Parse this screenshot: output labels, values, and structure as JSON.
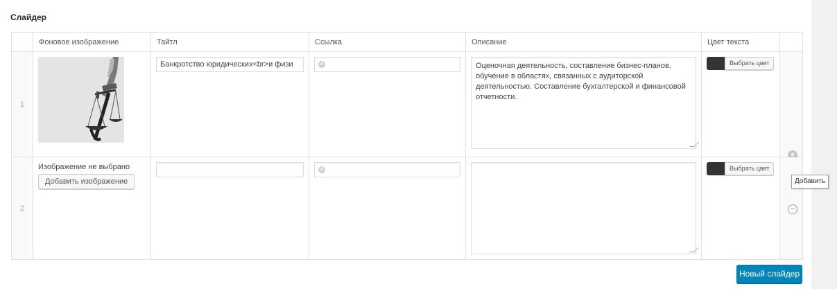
{
  "section_title": "Слайдер",
  "columns": {
    "bg_image": "Фоновое изображение",
    "title": "Тайтл",
    "link": "Ссылка",
    "description": "Описание",
    "text_color": "Цвет текста"
  },
  "rows": [
    {
      "order": "1",
      "image": "scales-of-justice",
      "title_value": "Банкротство юридических<br>и физи",
      "link_value": "",
      "description": "Оценочная деятельность, составление бизнес-планов, обучение в областях, связанных с аудиторской деятельностью. Составление бухгалтерской и финансовой отчетности.",
      "color_button": "Выбрать цвет",
      "color": "#333333"
    },
    {
      "order": "2",
      "no_image_text": "Изображение не выбрано",
      "add_image_label": "Добавить изображение",
      "title_value": "",
      "link_value": "",
      "description": "",
      "color_button": "Выбрать цвет",
      "color": "#333333"
    }
  ],
  "row_actions": {
    "add_icon": "plus-circle-icon",
    "remove_icon": "minus-circle-icon",
    "tooltip": "Добавить"
  },
  "new_slider_button": "Новый слайдер",
  "colors": {
    "primary": "#0085ba",
    "swatch": "#333333"
  }
}
